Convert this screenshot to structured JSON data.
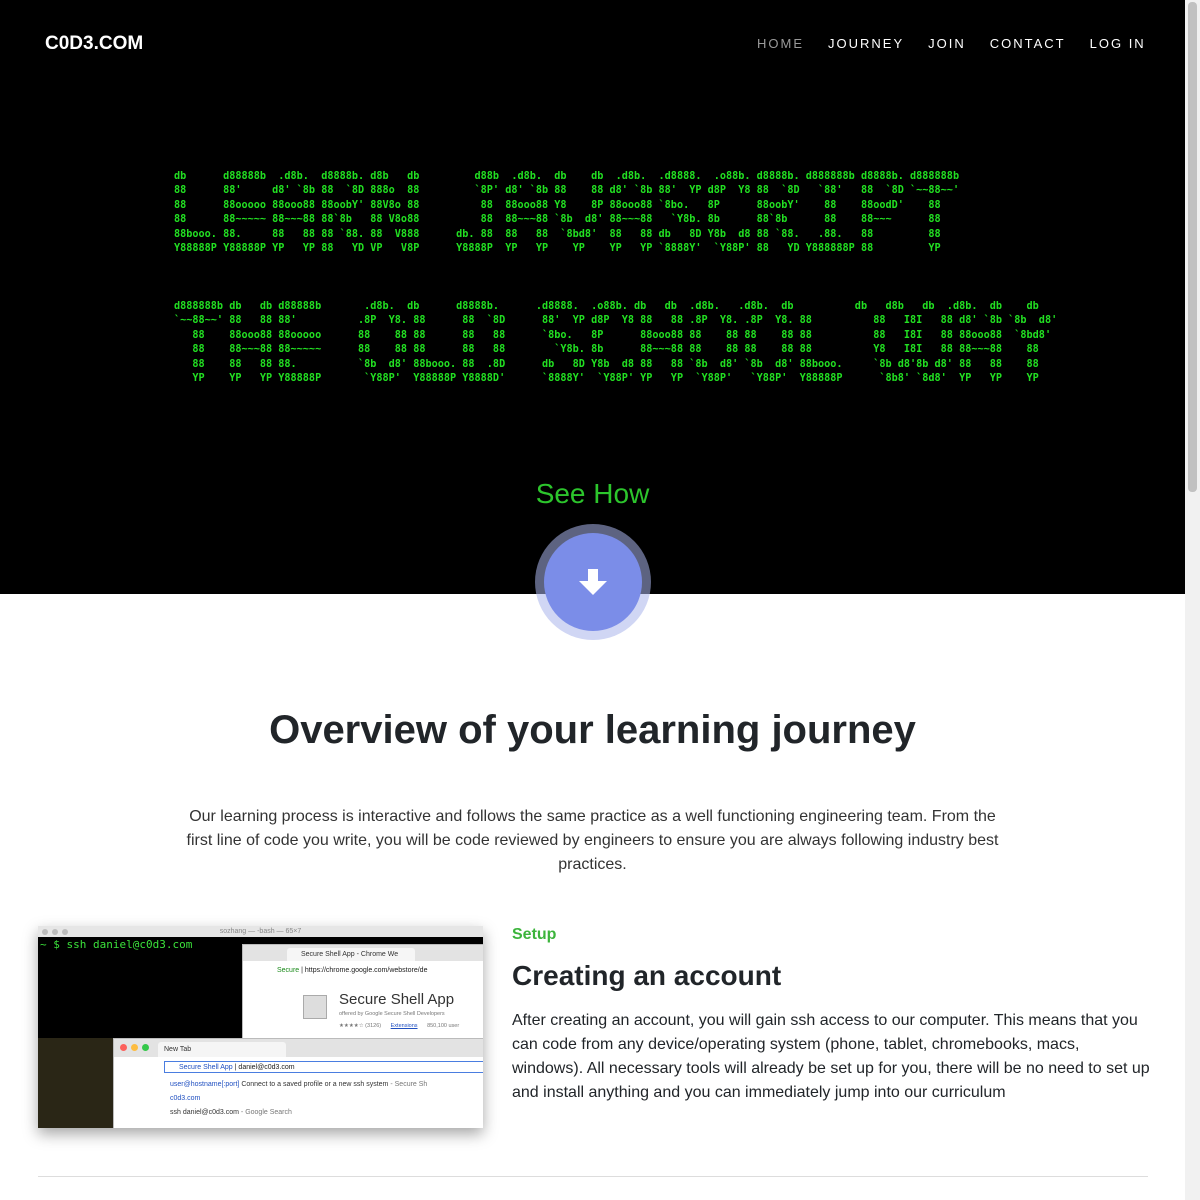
{
  "header": {
    "brand": "C0D3.COM",
    "nav": [
      {
        "label": "HOME",
        "active": true
      },
      {
        "label": "JOURNEY",
        "active": false
      },
      {
        "label": "JOIN",
        "active": false
      },
      {
        "label": "CONTACT",
        "active": false
      },
      {
        "label": "LOG IN",
        "active": false
      }
    ]
  },
  "hero": {
    "ascii_line1": [
      "db      d88888b  .d8b.  d8888b. d8b   db         d88b  .d8b.  db    db  .d8b.  .d8888.  .o88b. d8888b. d888888b d8888b. d888888b",
      "88      88'     d8' `8b 88  `8D 888o  88         `8P' d8' `8b 88    88 d8' `8b 88'  YP d8P  Y8 88  `8D   `88'   88  `8D `~~88~~'",
      "88      88ooooo 88ooo88 88oobY' 88V8o 88          88  88ooo88 Y8    8P 88ooo88 `8bo.   8P      88oobY'    88    88oodD'    88",
      "88      88~~~~~ 88~~~88 88`8b   88 V8o88          88  88~~~88 `8b  d8' 88~~~88   `Y8b. 8b      88`8b      88    88~~~      88",
      "88booo. 88.     88   88 88 `88. 88  V888      db. 88  88   88  `8bd8'  88   88 db   8D Y8b  d8 88 `88.   .88.   88         88",
      "Y88888P Y88888P YP   YP 88   YD VP   V8P      Y8888P  YP   YP    YP    YP   YP `8888Y'  `Y88P' 88   YD Y888888P 88         YP"
    ],
    "ascii_line2": [
      "d888888b db   db d88888b       .d8b.  db      d8888b.      .d8888.  .o88b. db   db  .d8b.   .d8b.  db          db   d8b   db  .d8b.  db    db",
      "`~~88~~' 88   88 88'          .8P  Y8. 88      88  `8D      88'  YP d8P  Y8 88   88 .8P  Y8. .8P  Y8. 88          88   I8I   88 d8' `8b `8b  d8'",
      "   88    88ooo88 88ooooo      88    88 88      88   88      `8bo.   8P      88ooo88 88    88 88    88 88          88   I8I   88 88ooo88  `8bd8'",
      "   88    88~~~88 88~~~~~      88    88 88      88   88        `Y8b. 8b      88~~~88 88    88 88    88 88          Y8   I8I   88 88~~~88    88",
      "   88    88   88 88.          `8b  d8' 88booo. 88  .8D      db   8D Y8b  d8 88   88 `8b  d8' `8b  d8' 88booo.     `8b d8'8b d8' 88   88    88",
      "   YP    YP   YP Y88888P       `Y88P'  Y88888P Y8888D'      `8888Y'  `Y88P' YP   YP  `Y88P'   `Y88P'  Y88888P      `8b8' `8d8'  YP   YP    YP"
    ],
    "see_how": "See How"
  },
  "overview": {
    "title": "Overview of your learning journey",
    "intro": "Our learning process is interactive and follows the same practice as a well functioning engineering team. From the first line of code you write, you will be code reviewed by engineers to ensure you are always following industry best practices."
  },
  "screenshot": {
    "terminal_title": "sozhang — -bash — 65×7",
    "terminal_command": "~ $ ssh daniel@c0d3.com",
    "chrome_tab": "Secure Shell App - Chrome We",
    "secure_label": "Secure",
    "url": "https://chrome.google.com/webstore/de",
    "app_name": "Secure Shell App",
    "app_by": "offered by Google Secure Shell Developers",
    "app_rating": "★★★★☆ (3126)",
    "app_ext": "Extensions",
    "app_users": "850,100 user",
    "new_tab": "New Tab",
    "omnibox_app": "Secure Shell App",
    "omnibox_text": "daniel@c0d3.com",
    "suggest1_blue": "user@hostname[:port]",
    "suggest1_rest": " Connect to a saved profile or a new ssh system",
    "suggest1_grey": " - Secure Sh",
    "suggest2": "c0d3.com",
    "suggest3": "ssh daniel@c0d3.com",
    "suggest3_grey": " - Google Search"
  },
  "card": {
    "label": "Setup",
    "title": "Creating an account",
    "body": "After creating an account, you will gain ssh access to our computer. This means that you can code from any device/operating system (phone, tablet, chromebooks, macs, windows). All necessary tools will already be set up for you, there will be no need to set up and install anything and you can immediately jump into our curriculum"
  },
  "colors": {
    "ascii_green": "#22e022",
    "see_how_green": "#2cc52c",
    "button_blue": "#7b8de8",
    "setup_green": "#3cb43c"
  }
}
